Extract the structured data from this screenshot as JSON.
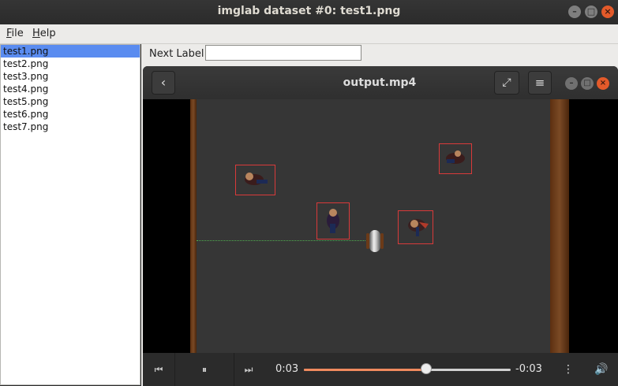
{
  "window": {
    "title": "imglab dataset #0: test1.png",
    "buttons": {
      "minimize": "–",
      "maximize": "□",
      "close": "×"
    }
  },
  "menubar": {
    "file": {
      "mnemonic": "F",
      "rest": "ile"
    },
    "help": {
      "mnemonic": "H",
      "rest": "elp"
    }
  },
  "filelist": {
    "items": [
      "test1.png",
      "test2.png",
      "test3.png",
      "test4.png",
      "test5.png",
      "test6.png",
      "test7.png"
    ],
    "selected_index": 0
  },
  "label_bar": {
    "label": "Next Label:",
    "value": ""
  },
  "player": {
    "title": "output.mp4",
    "back_icon": "‹",
    "fullscreen_icon": "⤢",
    "menu_icon": "≡",
    "window_buttons": {
      "minimize": "–",
      "maximize": "□",
      "close": "×"
    },
    "controls": {
      "prev_icon": "⏮",
      "pause_icon": "⏸",
      "next_icon": "⏭",
      "current_time": "0:03",
      "remaining_time": "-0:03",
      "progress": 0.59,
      "more_icon": "⋮",
      "volume_icon": "🔊",
      "accent": "#f08a5e"
    }
  },
  "colors": {
    "selection": "#5a8cf0",
    "bbox": "#d93a3a",
    "close": "#e35a2a"
  }
}
